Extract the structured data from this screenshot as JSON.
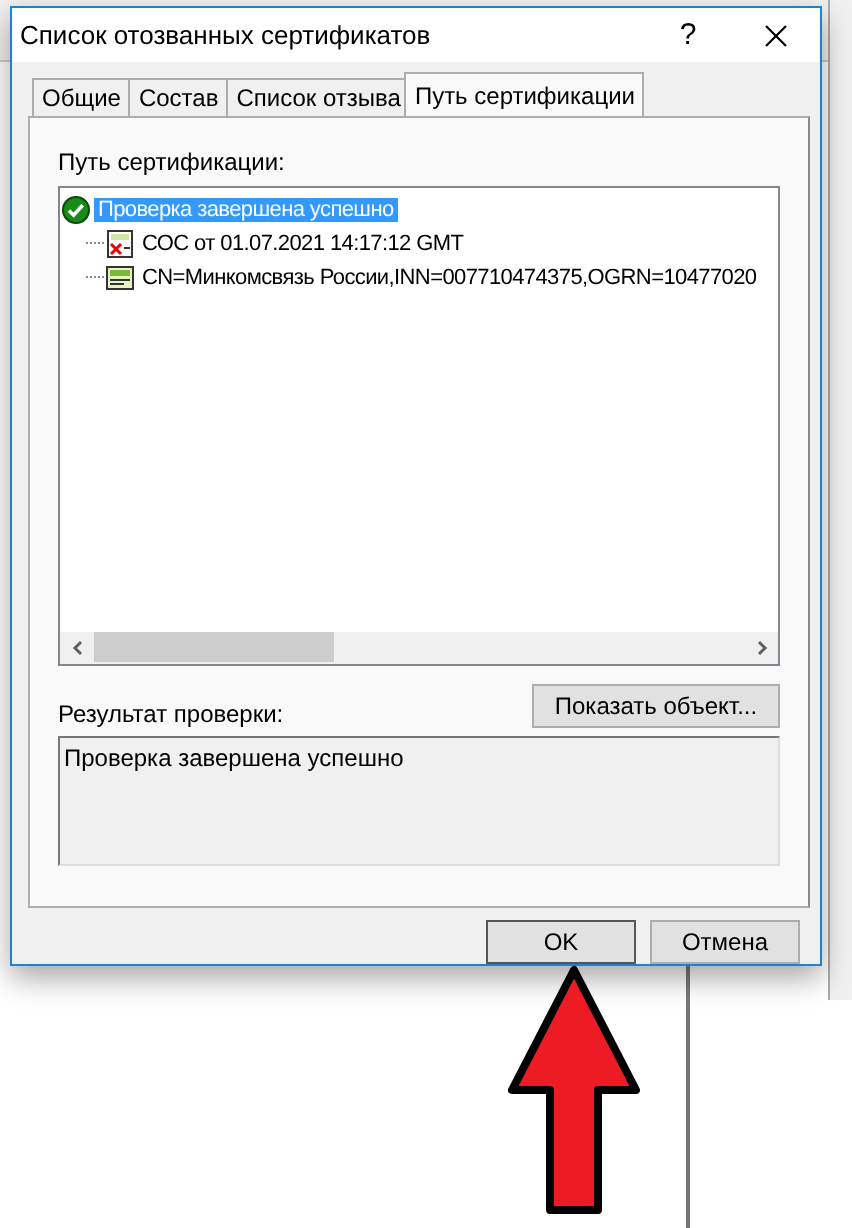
{
  "window": {
    "title": "Список отозванных сертификатов",
    "help_button": "?"
  },
  "tabs": [
    {
      "label": "Общие",
      "selected": false
    },
    {
      "label": "Состав",
      "selected": false
    },
    {
      "label": "Список отзыва",
      "selected": false
    },
    {
      "label": "Путь сертификации",
      "selected": true
    }
  ],
  "path_label": "Путь сертификации:",
  "tree": [
    {
      "kind": "status",
      "label": "Проверка завершена успешно",
      "selected": true,
      "children": [
        {
          "kind": "crl",
          "label": "СОС от 01.07.2021 14:17:12 GMT",
          "selected": false
        },
        {
          "kind": "cert",
          "label": "CN=Минкомсвязь России,INN=007710474375,OGRN=10477020",
          "selected": false
        }
      ]
    }
  ],
  "show_button": "Показать объект...",
  "result_label": "Результат проверки:",
  "result_text": "Проверка завершена успешно",
  "buttons": [
    {
      "label": "OK",
      "selected": true
    },
    {
      "label": "Отмена",
      "selected": false
    }
  ]
}
